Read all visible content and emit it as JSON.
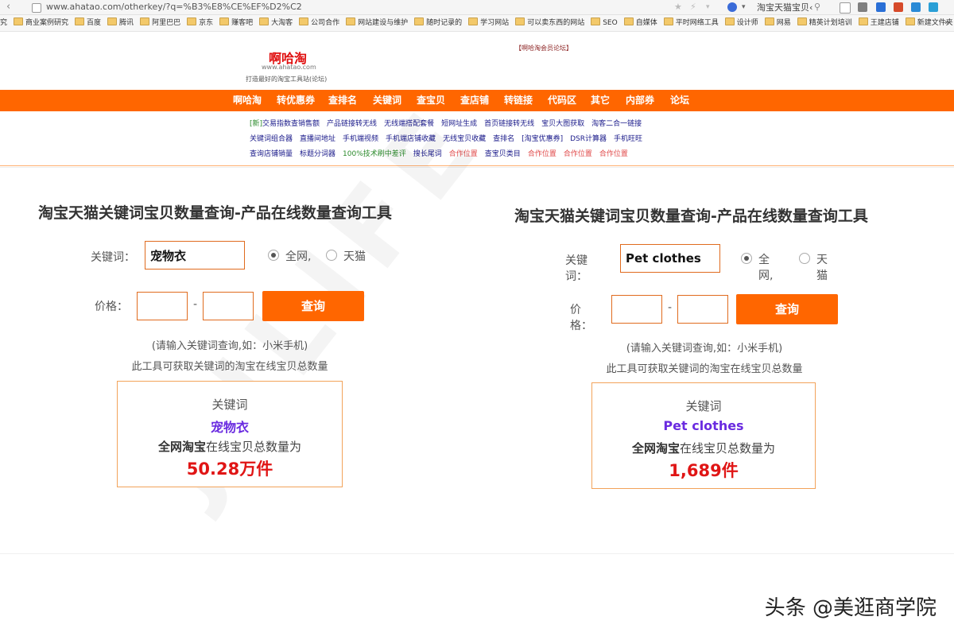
{
  "browser": {
    "url": "www.ahatao.com/otherkey/?q=%B3%E8%CE%EF%D2%C2",
    "search_text": "淘宝天猫宝贝‹",
    "bookmarks": [
      "究",
      "商业案例研究",
      "百度",
      "腾讯",
      "阿里巴巴",
      "京东",
      "赚客吧",
      "大淘客",
      "公司合作",
      "网站建设与维护",
      "随时记录的",
      "学习网站",
      "可以卖东西的网站",
      "SEO",
      "自媒体",
      "平时网络工具",
      "设计师",
      "网易",
      "精英计划培训",
      "王建店铺",
      "新建文件夹"
    ],
    "bookmarks_more": "»"
  },
  "header": {
    "logo_title": "啊哈淘",
    "logo_url": "www.ahatao.com",
    "slogan": "打造最好的淘宝工具站(论坛)",
    "member_link": "【啊哈淘会员论坛】"
  },
  "main_nav": [
    "啊哈淘",
    "转优惠券",
    "查排名",
    "关键词",
    "查宝贝",
    "查店铺",
    "转链接",
    "代码区",
    "其它",
    "内部券",
    "论坛"
  ],
  "link_rows": [
    [
      {
        "text": "[新]",
        "style": "green"
      },
      {
        "text": "交易指数查销售额",
        "style": "normal"
      },
      {
        "text": "产品链接转无线",
        "style": "normal"
      },
      {
        "text": "无线端搭配套餐",
        "style": "normal"
      },
      {
        "text": "短网址生成",
        "style": "normal"
      },
      {
        "text": "首页链接转无线",
        "style": "normal"
      },
      {
        "text": "宝贝大图获取",
        "style": "normal"
      },
      {
        "text": "淘客二合一链接",
        "style": "normal"
      }
    ],
    [
      {
        "text": "关键词组合器",
        "style": "normal"
      },
      {
        "text": "直播间地址",
        "style": "normal"
      },
      {
        "text": "手机端视频",
        "style": "normal"
      },
      {
        "text": "手机端店铺收藏",
        "style": "normal"
      },
      {
        "text": "无线宝贝收藏",
        "style": "normal"
      },
      {
        "text": "查排名",
        "style": "normal"
      },
      {
        "text": "[淘宝优惠券]",
        "style": "normal"
      },
      {
        "text": "DSR计算器",
        "style": "normal"
      },
      {
        "text": "手机旺旺",
        "style": "normal"
      }
    ],
    [
      {
        "text": "查询店铺销量",
        "style": "normal"
      },
      {
        "text": "标题分词器",
        "style": "normal"
      },
      {
        "text": "100%技术刷中差评",
        "style": "green"
      },
      {
        "text": "搜长尾词",
        "style": "normal"
      },
      {
        "text": "合作位置",
        "style": "red"
      },
      {
        "text": "查宝贝类目",
        "style": "normal"
      },
      {
        "text": "合作位置",
        "style": "red"
      },
      {
        "text": "合作位置",
        "style": "red"
      },
      {
        "text": "合作位置",
        "style": "red"
      }
    ]
  ],
  "panels": [
    {
      "title": "淘宝天猫关键词宝贝数量查询-产品在线数量查询工具",
      "keyword_label": "关键词：",
      "keyword_value": "宠物衣",
      "radio_all": "全网,",
      "radio_tmall": "天猫",
      "price_label": "价格：",
      "price_dash": "-",
      "query_button": "查询",
      "hint_1": "(请输入关键词查询,如：小米手机)",
      "hint_2": "此工具可获取关键词的淘宝在线宝贝总数量",
      "result_label": "关键词",
      "result_keyword": "宠物衣",
      "result_desc_bold": "全网淘宝",
      "result_desc": "在线宝贝总数量为",
      "result_count": "50.28万件"
    },
    {
      "title": "淘宝天猫关键词宝贝数量查询-产品在线数量查询工具",
      "keyword_label": "关键词：",
      "keyword_value": "Pet clothes",
      "radio_all": "全网,",
      "radio_tmall": "天猫",
      "price_label": "价格：",
      "price_dash": "-",
      "query_button": "查询",
      "hint_1": "(请输入关键词查询,如：小米手机)",
      "hint_2": "此工具可获取关键词的淘宝在线宝贝总数量",
      "result_label": "关键词",
      "result_keyword": "Pet clothes",
      "result_desc_bold": "全网淘宝",
      "result_desc": "在线宝贝总数量为",
      "result_count": "1,689件"
    }
  ],
  "watermark": "JULIFE",
  "source_credit": "头条 @美逛商学院",
  "colors": {
    "nav_orange": "#ff6600",
    "logo_red": "#e01010",
    "keyword_purple": "#6a2be0",
    "count_red": "#e01515"
  }
}
